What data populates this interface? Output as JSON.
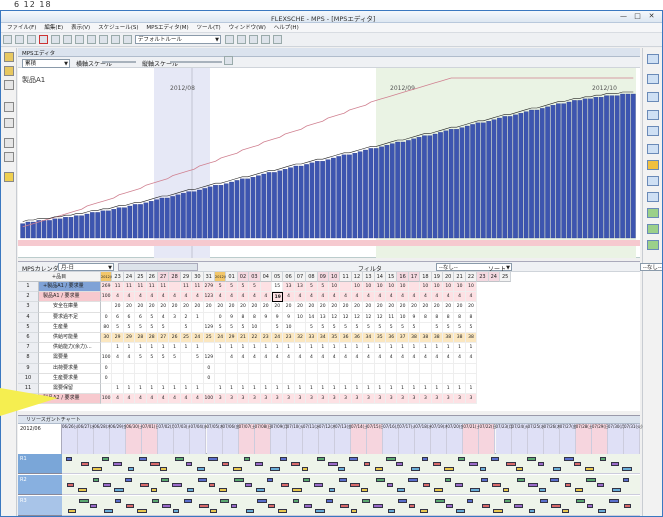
{
  "top_fragment": {
    "text": "6   12  18"
  },
  "app": {
    "title": "FLEXSCHE - MPS - [MPSエディタ]",
    "min": "—",
    "max": "□",
    "close": "✕"
  },
  "menu": [
    "ファイル(F)",
    "編集(E)",
    "表示(V)",
    "スケジュール(S)",
    "MPSエディタ(M)",
    "ツール(T)",
    "ウィンドウ(W)",
    "ヘルプ(H)"
  ],
  "toolbar": {
    "rule_combo": "デフォルトルール"
  },
  "mps_tab": {
    "label": "MPSエディタ"
  },
  "chart_toolbar": {
    "mode_combo": "累積",
    "h_scale": "横軸スケール",
    "v_scale": "縦軸スケール"
  },
  "chart_data": {
    "type": "bar",
    "title": "製品A1",
    "month_labels": [
      "2012/08",
      "2012/09",
      "2012/10"
    ],
    "series": [
      {
        "name": "",
        "kind": "bar",
        "values": [
          9,
          10,
          10,
          11,
          11,
          11,
          12,
          12,
          13,
          13,
          14,
          14,
          15,
          16,
          16,
          17,
          17,
          18,
          19,
          19,
          20,
          21,
          21,
          22,
          23,
          24,
          25,
          25,
          26,
          27,
          28,
          29,
          29,
          30,
          31,
          32,
          33,
          33,
          34,
          35,
          36,
          37,
          37,
          38,
          39,
          40,
          41,
          41,
          42,
          43,
          44,
          45,
          45,
          46,
          47,
          48,
          48,
          49,
          50,
          51,
          52,
          52,
          53,
          54,
          55,
          56,
          56,
          57,
          58,
          59,
          60,
          60,
          61,
          62,
          63,
          64,
          64,
          65,
          66,
          67,
          68,
          68,
          69,
          70,
          71,
          72,
          72,
          73,
          74,
          75,
          76,
          76,
          77,
          78,
          79,
          80,
          80,
          81,
          82,
          83,
          84,
          84,
          85,
          86,
          86,
          87,
          87,
          88,
          88,
          89,
          89,
          89,
          90,
          90,
          90
        ]
      },
      {
        "name": "",
        "kind": "line",
        "values": [
          7,
          8,
          9,
          10,
          11,
          12,
          13,
          14,
          15,
          16,
          17,
          18,
          20,
          21,
          22,
          23,
          24,
          25,
          27,
          28,
          29,
          30,
          31,
          33,
          34,
          35,
          36,
          37,
          39,
          40,
          41,
          42,
          43,
          45,
          46,
          47,
          48,
          50,
          51,
          52,
          53,
          55,
          56,
          57,
          58,
          60,
          61,
          62,
          63,
          65,
          66,
          67,
          68,
          70,
          71,
          72,
          73,
          75,
          76,
          77,
          78,
          80,
          81,
          82,
          83,
          85,
          86,
          87,
          88,
          89,
          90,
          91,
          92,
          93,
          94,
          95,
          96,
          97,
          98,
          99,
          100,
          100,
          100,
          100,
          100,
          100,
          100,
          100,
          100,
          100,
          100,
          100,
          100,
          100,
          100,
          100,
          100,
          100,
          100,
          100,
          100,
          100,
          100,
          100,
          100,
          100,
          100,
          100,
          100,
          100,
          100,
          100,
          100,
          100,
          100
        ]
      }
    ]
  },
  "grid_toolbar": {
    "calendar_label": "MPSカレンダー",
    "calendar_value": "月-日",
    "filter_label": "フィルタ",
    "filter_value": "--なし--",
    "sort_label": "ソート",
    "sort_value": "--なし--"
  },
  "grid": {
    "corner": "+品目",
    "dates": [
      "2012/07",
      "23",
      "24",
      "25",
      "26",
      "27",
      "28",
      "29",
      "30",
      "31",
      "2012/08",
      "01",
      "02",
      "03",
      "04",
      "05",
      "06",
      "07",
      "08",
      "09",
      "10",
      "11",
      "12",
      "13",
      "14",
      "15",
      "16",
      "17",
      "18",
      "19",
      "20",
      "21",
      "22",
      "23",
      "24",
      "25"
    ],
    "rows": [
      {
        "num": "1",
        "label": "+製品A1 / 要求量",
        "cells": [
          "269",
          "11",
          "11",
          "11",
          "11",
          "11",
          "",
          "11",
          "11",
          "279",
          "5",
          "5",
          "5",
          "5",
          "",
          "15",
          "13",
          "13",
          "5",
          "5",
          "10",
          "",
          "10",
          "10",
          "10",
          "10",
          "10",
          "",
          "10",
          "10",
          "10",
          "10",
          "10"
        ]
      },
      {
        "num": "2",
        "label": "製品A1 / 要求量",
        "cells": [
          "100",
          "4",
          "4",
          "4",
          "4",
          "4",
          "4",
          "4",
          "4",
          "123",
          "4",
          "4",
          "4",
          "4",
          "4",
          "19",
          "4",
          "4",
          "4",
          "4",
          "4",
          "4",
          "4",
          "4",
          "4",
          "4",
          "4",
          "4",
          "4",
          "4",
          "4",
          "4",
          "4"
        ]
      },
      {
        "num": "3",
        "label": "安全在庫量",
        "cells": [
          "",
          "20",
          "20",
          "20",
          "20",
          "20",
          "20",
          "20",
          "20",
          "20",
          "20",
          "20",
          "20",
          "20",
          "20",
          "20",
          "20",
          "20",
          "20",
          "20",
          "20",
          "20",
          "20",
          "20",
          "20",
          "20",
          "20",
          "20",
          "20",
          "20",
          "20",
          "20",
          "20"
        ]
      },
      {
        "num": "4",
        "label": "要求過不足",
        "cells": [
          "0",
          "6",
          "6",
          "6",
          "5",
          "4",
          "3",
          "2",
          "1",
          "",
          "0",
          "9",
          "8",
          "8",
          "9",
          "9",
          "9",
          "10",
          "14",
          "13",
          "12",
          "12",
          "12",
          "12",
          "12",
          "11",
          "10",
          "9",
          "8",
          "8",
          "8",
          "8",
          "8"
        ]
      },
      {
        "num": "5",
        "label": "生産量",
        "cells": [
          "80",
          "5",
          "5",
          "5",
          "5",
          "5",
          "",
          "5",
          "",
          "129",
          "5",
          "5",
          "5",
          "10",
          "",
          "5",
          "10",
          "",
          "5",
          "5",
          "5",
          "5",
          "5",
          "5",
          "5",
          "5",
          "5",
          "5",
          "",
          "5",
          "5",
          "5",
          "5"
        ]
      },
      {
        "num": "6",
        "label": "供給可能量",
        "cells": [
          "30",
          "29",
          "29",
          "28",
          "28",
          "27",
          "26",
          "25",
          "24",
          "25",
          "24",
          "29",
          "21",
          "22",
          "23",
          "24",
          "23",
          "32",
          "33",
          "34",
          "35",
          "36",
          "36",
          "34",
          "35",
          "36",
          "37",
          "38",
          "38",
          "38",
          "38",
          "38",
          "38"
        ]
      },
      {
        "num": "7",
        "label": "供給能力(余力)...",
        "cells": [
          "",
          "1",
          "1",
          "1",
          "1",
          "1",
          "1",
          "1",
          "1",
          "",
          "1",
          "1",
          "1",
          "1",
          "1",
          "1",
          "1",
          "1",
          "1",
          "1",
          "1",
          "1",
          "1",
          "1",
          "1",
          "1",
          "1",
          "1",
          "1",
          "1",
          "1",
          "1",
          "1"
        ]
      },
      {
        "num": "8",
        "label": "需要量",
        "cells": [
          "100",
          "4",
          "4",
          "5",
          "5",
          "5",
          "5",
          "",
          "5",
          "129",
          "",
          "4",
          "4",
          "4",
          "4",
          "4",
          "4",
          "4",
          "4",
          "4",
          "4",
          "4",
          "4",
          "4",
          "4",
          "4",
          "4",
          "4",
          "4",
          "4",
          "4",
          "4",
          "4"
        ]
      },
      {
        "num": "9",
        "label": "出荷要求量",
        "cells": [
          "0",
          "",
          "",
          "",
          "",
          "",
          "",
          "",
          "",
          "0",
          "",
          "",
          "",
          "",
          "",
          "",
          "",
          "",
          "",
          "",
          "",
          "",
          "",
          "",
          "",
          "",
          "",
          "",
          "",
          "",
          "",
          "",
          ""
        ]
      },
      {
        "num": "10",
        "label": "生産要求量",
        "cells": [
          "0",
          "",
          "",
          "",
          "",
          "",
          "",
          "",
          "",
          "0",
          "",
          "",
          "",
          "",
          "",
          "",
          "",
          "",
          "",
          "",
          "",
          "",
          "",
          "",
          "",
          "",
          "",
          "",
          "",
          "",
          "",
          "",
          ""
        ]
      },
      {
        "num": "11",
        "label": "需要保留",
        "cells": [
          "",
          "1",
          "1",
          "1",
          "1",
          "1",
          "1",
          "1",
          "1",
          "",
          "1",
          "1",
          "1",
          "1",
          "1",
          "1",
          "1",
          "1",
          "1",
          "1",
          "1",
          "1",
          "1",
          "1",
          "1",
          "1",
          "1",
          "1",
          "1",
          "1",
          "1",
          "1",
          "1"
        ]
      },
      {
        "num": "1",
        "label": "製品A2 / 要求量",
        "cells": [
          "100",
          "4",
          "4",
          "4",
          "4",
          "4",
          "4",
          "4",
          "4",
          "100",
          "3",
          "3",
          "3",
          "3",
          "3",
          "3",
          "3",
          "3",
          "3",
          "3",
          "3",
          "3",
          "3",
          "3",
          "3",
          "3",
          "3",
          "3",
          "3",
          "3",
          "3",
          "3",
          "3"
        ]
      }
    ]
  },
  "gantt": {
    "tab": "リソースガントチャート",
    "corner": "2012/06",
    "days": [
      "06/26(火)",
      "06/27(水)",
      "06/28(木)",
      "06/29(金)",
      "06/30(土)",
      "07/01(日)",
      "07/02(月)",
      "07/03(火)",
      "07/04(水)",
      "07/05(木)",
      "07/06(金)",
      "07/07(土)",
      "07/08(日)",
      "07/09(月)",
      "07/10(火)",
      "07/11(水)",
      "07/12(木)",
      "07/13(金)",
      "07/14(土)",
      "07/15(日)",
      "07/16(月)",
      "07/17(火)",
      "07/18(水)",
      "07/19(木)",
      "07/20(金)",
      "07/21(土)",
      "07/22(日)",
      "07/23(月)",
      "07/24(火)",
      "07/25(水)",
      "07/26(木)",
      "07/27(金)",
      "07/28(土)",
      "07/29(日)",
      "07/30(月)",
      "07/31(火)"
    ],
    "resources": [
      "R1",
      "R2",
      "R3"
    ]
  }
}
